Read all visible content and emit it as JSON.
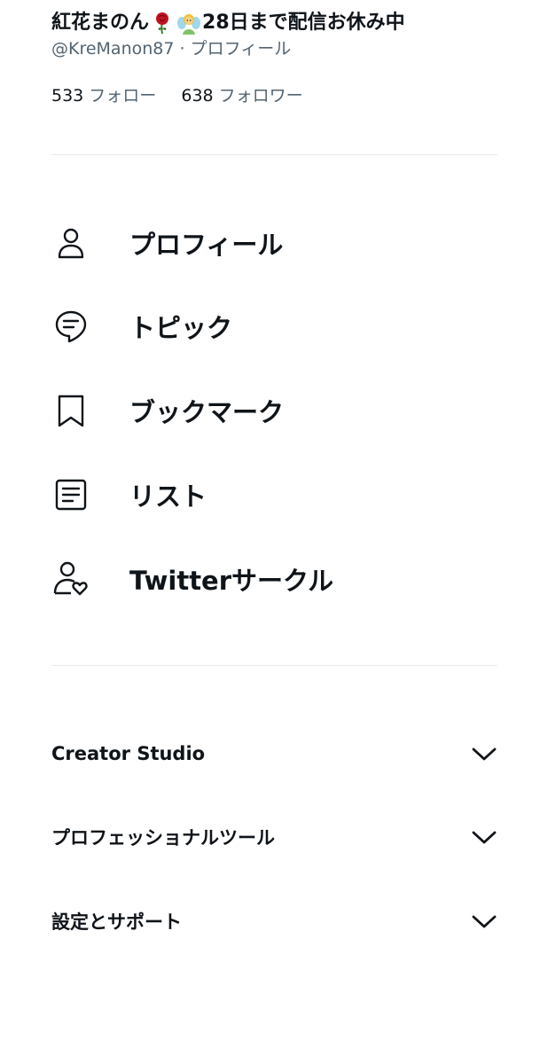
{
  "profile": {
    "name_part1": "紅花まのん",
    "rose_emoji": "🌹",
    "person_emoji": "🧚",
    "name_part2": "28日まで配信お休み中",
    "handle": "@KreManon87",
    "handle_suffix": " · プロフィール"
  },
  "follow": {
    "following_count": "533",
    "following_label": "フォロー",
    "followers_count": "638",
    "followers_label": "フォロワー"
  },
  "menu": {
    "items": [
      {
        "label": "プロフィール",
        "icon": "person-icon"
      },
      {
        "label": "トピック",
        "icon": "topic-icon"
      },
      {
        "label": "ブックマーク",
        "icon": "bookmark-icon"
      },
      {
        "label": "リスト",
        "icon": "list-icon"
      },
      {
        "label": "Twitterサークル",
        "icon": "circle-icon"
      }
    ]
  },
  "sections": {
    "items": [
      {
        "label": "Creator Studio",
        "icon": "chevron-down-icon"
      },
      {
        "label": "プロフェッショナルツール",
        "icon": "chevron-down-icon"
      },
      {
        "label": "設定とサポート",
        "icon": "chevron-down-icon"
      }
    ]
  },
  "colors": {
    "text_primary": "#0f1419",
    "text_secondary": "#536471",
    "divider": "#e7e9ee",
    "background": "#ffffff"
  }
}
